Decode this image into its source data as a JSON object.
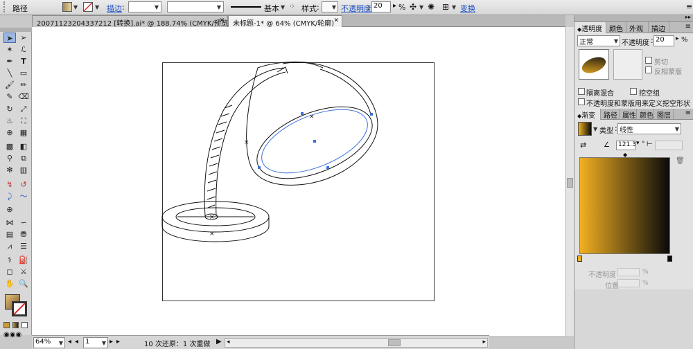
{
  "control_bar": {
    "object_type": "路径",
    "stroke_label": "描边",
    "stroke_style": "基本",
    "style_label": "样式",
    "opacity_label": "不透明度",
    "opacity_value": "20",
    "opacity_unit": "%",
    "transform_label": "变换"
  },
  "tabs": [
    {
      "label": "20071123204337212 [转换].ai* @ 188.74% (CMYK/预览)"
    },
    {
      "label": "未标题-1* @ 64% (CMYK/轮廓)"
    }
  ],
  "transparency_panel": {
    "tabs": [
      "透明度",
      "颜色",
      "外观",
      "描边"
    ],
    "blend_mode": "正常",
    "opacity_label": "不透明度",
    "opacity_value": "20",
    "opacity_unit": "%",
    "clip_label": "剪切",
    "invert_mask_label": "反相蒙版",
    "isolate_blend_label": "隔离混合",
    "knockout_group_label": "挖空组",
    "opacity_mask_label": "不透明度和蒙版用来定义挖空形状"
  },
  "gradient_panel": {
    "tabs": [
      "渐变",
      "路径",
      "属性",
      "颜色",
      "图层"
    ],
    "type_label": "类型",
    "type_value": "线性",
    "angle_value": "121.3",
    "angle_unit": "°",
    "stop_opacity_label": "不透明度",
    "location_label": "位置",
    "stop_start_color": "#f1b021",
    "stop_end_color": "#0a0a0a"
  },
  "status_bar": {
    "zoom": "64%",
    "page": "1",
    "undo_text": "10 次还原：1 次重做"
  },
  "colors": {
    "accent_link": "#1a4fc6",
    "selection_blue": "#3a6fd8"
  }
}
